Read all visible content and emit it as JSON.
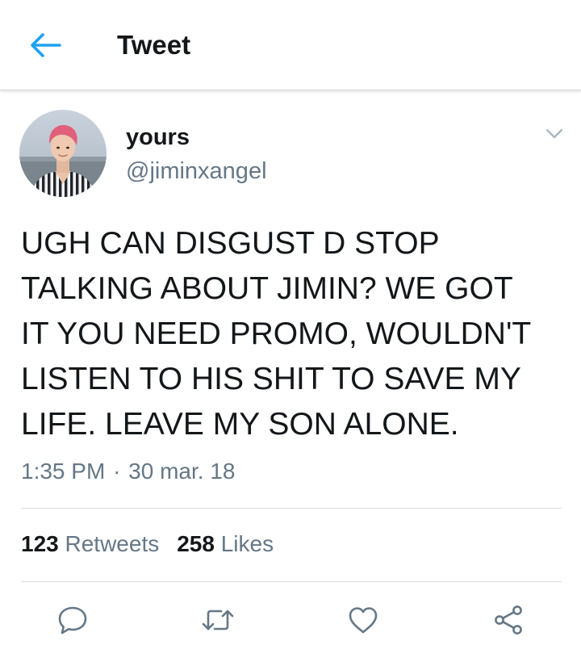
{
  "header": {
    "title": "Tweet",
    "back_icon": "arrow-left-icon",
    "accent_color": "#1da1f2"
  },
  "tweet": {
    "author": {
      "display_name": "yours",
      "handle": "@jiminxangel",
      "avatar_icon": "profile-photo"
    },
    "text": "UGH CAN DISGUST D STOP\nTALKING ABOUT JIMIN? WE GOT\nIT YOU NEED PROMO, WOULDN'T\nLISTEN TO HIS SHIT TO SAVE MY\nLIFE. LEAVE MY SON ALONE.",
    "time": "1:35 PM",
    "separator": "·",
    "date": "30 mar. 18",
    "stats": {
      "retweets_count": "123",
      "retweets_label": "Retweets",
      "likes_count": "258",
      "likes_label": "Likes"
    },
    "actions": [
      "reply-icon",
      "retweet-icon",
      "like-icon",
      "share-icon"
    ]
  },
  "colors": {
    "primary_text": "#14171a",
    "secondary_text": "#657786",
    "divider": "#d9dde0"
  }
}
